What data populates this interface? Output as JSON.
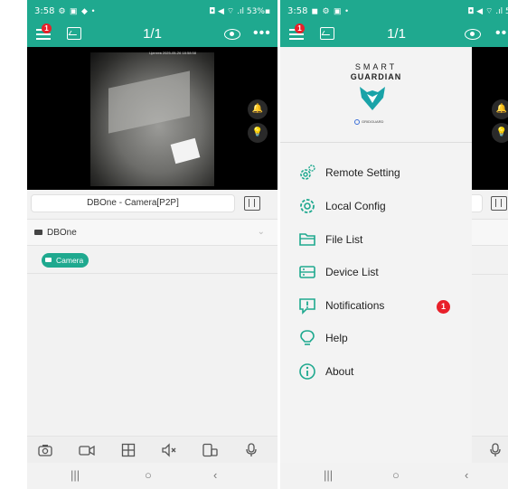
{
  "left_screen": {
    "status": {
      "time": "3:58",
      "icons": "⚙ ▣ ◆ •",
      "right": "◘ ◀ ⌔ .ıl 53%▪"
    },
    "appbar": {
      "menu_badge": "1",
      "page_count": "1/1",
      "more": "•••"
    },
    "video": {
      "osd": "Цептев 2025-05-26 18:58:58"
    },
    "camera_name": "DBOne - Camera[P2P]",
    "device": {
      "label": "DBOne"
    },
    "camera_chip": "Camera",
    "tools": [
      "snapshot-icon",
      "record-icon",
      "grid-icon",
      "mute-icon",
      "switch-icon",
      "mic-icon"
    ],
    "nav": {
      "recent": "|||",
      "home": "○",
      "back": "‹"
    }
  },
  "right_screen": {
    "status": {
      "time": "3:58",
      "icons": "◼ ⚙ ▣ •",
      "right": "◘ ◀ ⌔ .ıl 53%"
    },
    "appbar": {
      "menu_badge": "1",
      "page_count": "1/1"
    },
    "logo": {
      "line1": "SMART",
      "line2": "GUARDIAN",
      "sub": "GRIDGUARD"
    },
    "menu": [
      {
        "label": "Remote Setting",
        "icon": "remote-setting-icon"
      },
      {
        "label": "Local Config",
        "icon": "local-config-icon"
      },
      {
        "label": "File List",
        "icon": "folder-icon"
      },
      {
        "label": "Device List",
        "icon": "device-list-icon"
      },
      {
        "label": "Notifications",
        "icon": "notification-icon",
        "badge": "1"
      },
      {
        "label": "Help",
        "icon": "help-icon"
      },
      {
        "label": "About",
        "icon": "info-icon"
      }
    ],
    "nav": {
      "recent": "|||",
      "home": "○",
      "back": "‹"
    }
  },
  "colors": {
    "accent": "#1fa98f",
    "badge": "#e8202a"
  }
}
